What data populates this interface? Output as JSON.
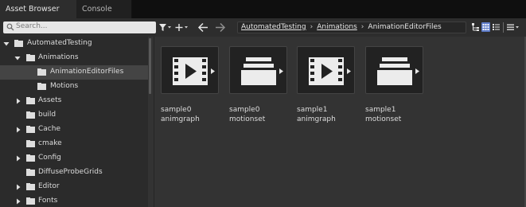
{
  "tabs": [
    {
      "label": "Asset Browser",
      "active": true
    },
    {
      "label": "Console",
      "active": false
    }
  ],
  "toolbar": {
    "search_placeholder": "Search...",
    "filter_icon": "filter-icon",
    "add_icon": "plus-icon",
    "back_icon": "arrow-left-icon",
    "forward_icon": "arrow-right-icon"
  },
  "breadcrumb": {
    "items": [
      "AutomatedTesting",
      "Animations"
    ],
    "separator": "›",
    "current": "AnimationEditorFiles"
  },
  "tree": [
    {
      "label": "AutomatedTesting",
      "expanded": true
    },
    {
      "label": "Animations",
      "expanded": true
    },
    {
      "label": "AnimationEditorFiles",
      "expanded": false,
      "selected": true
    },
    {
      "label": "Motions",
      "expanded": false
    },
    {
      "label": "Assets",
      "expanded": false
    },
    {
      "label": "build",
      "expanded": false
    },
    {
      "label": "Cache",
      "expanded": false
    },
    {
      "label": "cmake",
      "expanded": false
    },
    {
      "label": "Config",
      "expanded": false
    },
    {
      "label": "DiffuseProbeGrids",
      "expanded": false
    },
    {
      "label": "Editor",
      "expanded": false
    },
    {
      "label": "Fonts",
      "expanded": false
    }
  ],
  "assets": [
    {
      "name_line1": "sample0",
      "name_line2": "animgraph",
      "icon": "animgraph-icon"
    },
    {
      "name_line1": "sample0",
      "name_line2": "motionset",
      "icon": "motionset-icon"
    },
    {
      "name_line1": "sample1",
      "name_line2": "animgraph",
      "icon": "animgraph-icon"
    },
    {
      "name_line1": "sample1",
      "name_line2": "motionset",
      "icon": "motionset-icon"
    }
  ],
  "colors": {
    "accent": "#5d7bc8",
    "background": "#333333",
    "tree_background": "#2b2b2b"
  }
}
